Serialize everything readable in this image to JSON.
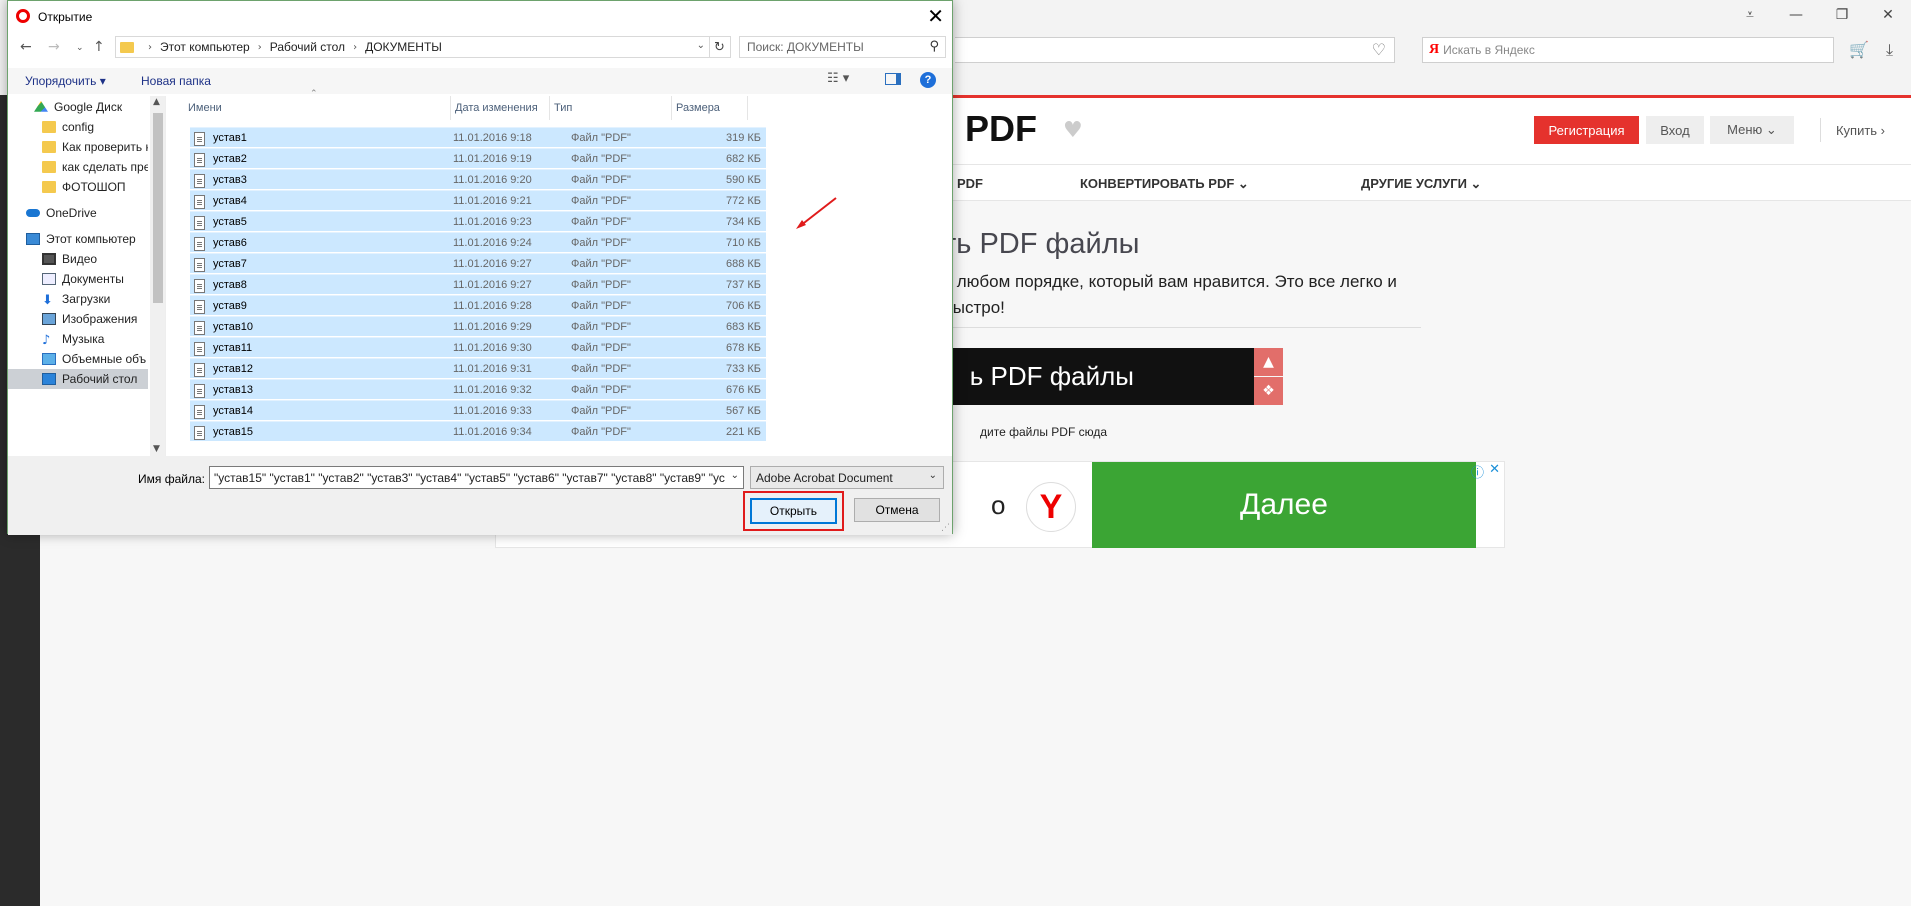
{
  "browser": {
    "search_placeholder": "Искать в Яндекс",
    "ya_letter": "Я",
    "window_controls": [
      "⩡",
      "—",
      "❐",
      "✕"
    ]
  },
  "site": {
    "logo": "PDF",
    "register": "Регистрация",
    "login": "Вход",
    "menu": "Меню ⌄",
    "buy": "Купить ›",
    "nav": [
      "PDF",
      "КОНВЕРТИРОВАТЬ PDF ⌄",
      "ДРУГИЕ УСЛУГИ ⌄"
    ],
    "hero_title": "ть PDF файлы",
    "hero_sub": "в любом порядке, который вам нравится. Это все легко и быстро!",
    "select_label": "ь PDF файлы",
    "drop_hint": "дите файлы PDF сюда",
    "ad_next": "Далее",
    "ad_letter": "Y",
    "ad_partial": "о"
  },
  "dialog": {
    "title": "Открытие",
    "close": "✕",
    "breadcrumb": [
      "Этот компьютер",
      "Рабочий стол",
      "ДОКУМЕНТЫ"
    ],
    "search_placeholder": "Поиск: ДОКУМЕНТЫ",
    "toolbar": {
      "organize": "Упорядочить ▾",
      "new_folder": "Новая папка"
    },
    "nav_items": [
      {
        "label": "Google Диск",
        "icon": "gdrive"
      },
      {
        "label": "config",
        "icon": "folder"
      },
      {
        "label": "Как проверить к",
        "icon": "folder"
      },
      {
        "label": "как сделать пре",
        "icon": "folder"
      },
      {
        "label": "ФОТОШОП",
        "icon": "folder"
      },
      {
        "label": "OneDrive",
        "icon": "onedrive"
      },
      {
        "label": "Этот компьютер",
        "icon": "pc"
      },
      {
        "label": "Видео",
        "icon": "video"
      },
      {
        "label": "Документы",
        "icon": "docs"
      },
      {
        "label": "Загрузки",
        "icon": "down"
      },
      {
        "label": "Изображения",
        "icon": "img"
      },
      {
        "label": "Музыка",
        "icon": "music"
      },
      {
        "label": "Объемные объ",
        "icon": "3d"
      },
      {
        "label": "Рабочий стол",
        "icon": "desk"
      }
    ],
    "columns": [
      "Имени",
      "Дата изменения",
      "Тип",
      "Размера"
    ],
    "files": [
      {
        "name": "устав1",
        "date": "11.01.2016 9:18",
        "type": "Файл \"PDF\"",
        "size": "319 КБ"
      },
      {
        "name": "устав2",
        "date": "11.01.2016 9:19",
        "type": "Файл \"PDF\"",
        "size": "682 КБ"
      },
      {
        "name": "устав3",
        "date": "11.01.2016 9:20",
        "type": "Файл \"PDF\"",
        "size": "590 КБ"
      },
      {
        "name": "устав4",
        "date": "11.01.2016 9:21",
        "type": "Файл \"PDF\"",
        "size": "772 КБ"
      },
      {
        "name": "устав5",
        "date": "11.01.2016 9:23",
        "type": "Файл \"PDF\"",
        "size": "734 КБ"
      },
      {
        "name": "устав6",
        "date": "11.01.2016 9:24",
        "type": "Файл \"PDF\"",
        "size": "710 КБ"
      },
      {
        "name": "устав7",
        "date": "11.01.2016 9:27",
        "type": "Файл \"PDF\"",
        "size": "688 КБ"
      },
      {
        "name": "устав8",
        "date": "11.01.2016 9:27",
        "type": "Файл \"PDF\"",
        "size": "737 КБ"
      },
      {
        "name": "устав9",
        "date": "11.01.2016 9:28",
        "type": "Файл \"PDF\"",
        "size": "706 КБ"
      },
      {
        "name": "устав10",
        "date": "11.01.2016 9:29",
        "type": "Файл \"PDF\"",
        "size": "683 КБ"
      },
      {
        "name": "устав11",
        "date": "11.01.2016 9:30",
        "type": "Файл \"PDF\"",
        "size": "678 КБ"
      },
      {
        "name": "устав12",
        "date": "11.01.2016 9:31",
        "type": "Файл \"PDF\"",
        "size": "733 КБ"
      },
      {
        "name": "устав13",
        "date": "11.01.2016 9:32",
        "type": "Файл \"PDF\"",
        "size": "676 КБ"
      },
      {
        "name": "устав14",
        "date": "11.01.2016 9:33",
        "type": "Файл \"PDF\"",
        "size": "567 КБ"
      },
      {
        "name": "устав15",
        "date": "11.01.2016 9:34",
        "type": "Файл \"PDF\"",
        "size": "221 КБ"
      }
    ],
    "filename_label": "Имя файла:",
    "filename_value": "\"устав15\" \"устав1\" \"устав2\" \"устав3\" \"устав4\" \"устав5\" \"устав6\" \"устав7\" \"устав8\" \"устав9\" \"ус",
    "filetype_value": "Adobe Acrobat Document",
    "open": "Открыть",
    "cancel": "Отмена"
  }
}
